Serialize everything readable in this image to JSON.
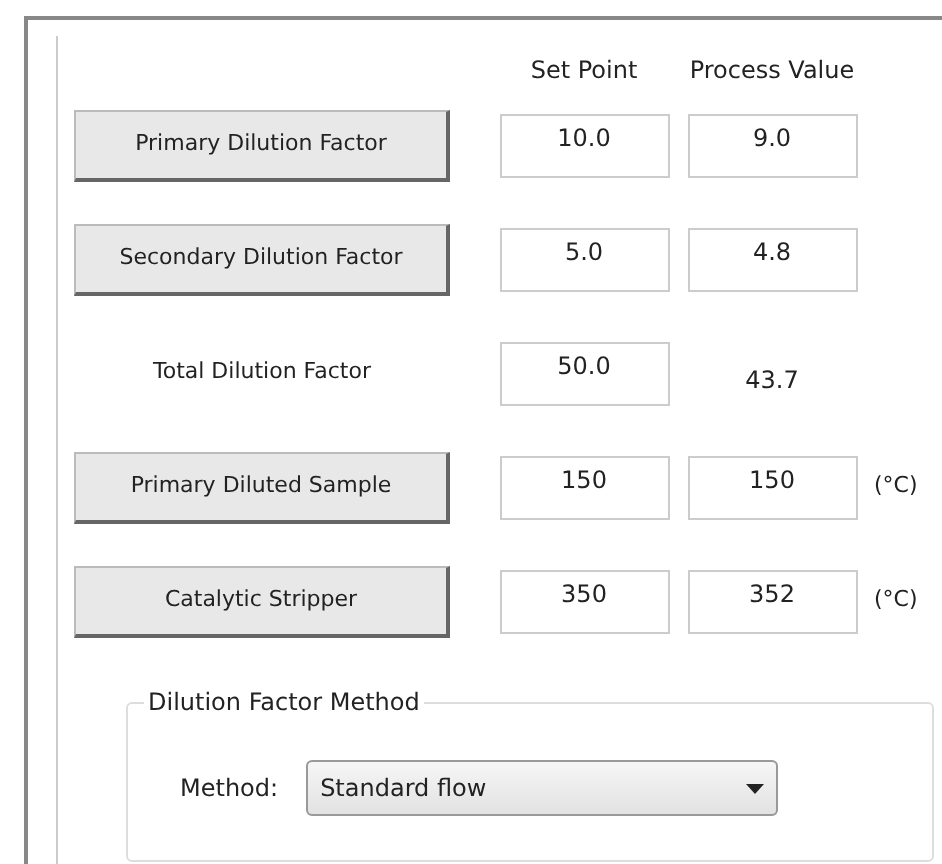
{
  "columns": [
    "Set Point",
    "Process Value"
  ],
  "rows": [
    {
      "kind": "button",
      "label": "Primary Dilution Factor",
      "set_point": "10.0",
      "process_value": {
        "kind": "field",
        "value": "9.0"
      }
    },
    {
      "kind": "button",
      "label": "Secondary Dilution Factor",
      "set_point": "5.0",
      "process_value": {
        "kind": "field",
        "value": "4.8"
      }
    },
    {
      "kind": "label",
      "label": "Total Dilution Factor",
      "set_point": "50.0",
      "process_value": {
        "kind": "text",
        "value": "43.7"
      }
    },
    {
      "kind": "button",
      "label": "Primary Diluted Sample",
      "set_point": "150",
      "process_value": {
        "kind": "field",
        "value": "150"
      },
      "unit": "(°C)"
    },
    {
      "kind": "button",
      "label": "Catalytic Stripper",
      "set_point": "350",
      "process_value": {
        "kind": "field",
        "value": "352"
      },
      "unit": "(°C)"
    }
  ],
  "dilution_factor_method": {
    "title": "Dilution Factor Method",
    "method_label": "Method:",
    "method": "Standard flow"
  }
}
